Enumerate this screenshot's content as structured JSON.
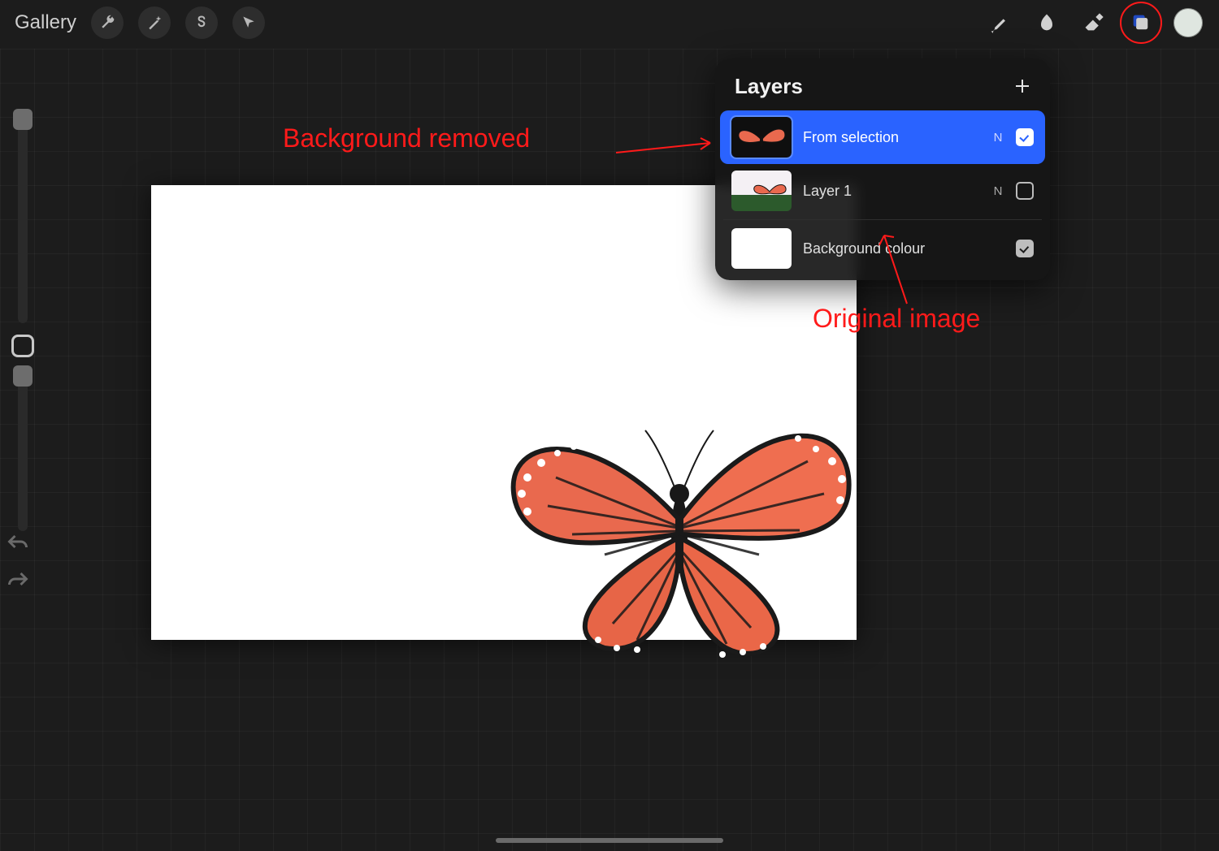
{
  "toolbar": {
    "gallery_label": "Gallery"
  },
  "layers_panel": {
    "title": "Layers",
    "rows": [
      {
        "name": "From selection",
        "blend": "N",
        "visible": true,
        "selected": true
      },
      {
        "name": "Layer 1",
        "blend": "N",
        "visible": false,
        "selected": false
      },
      {
        "name": "Background colour",
        "blend": "",
        "visible": true,
        "selected": false
      }
    ]
  },
  "annotations": {
    "bg_removed": "Background removed",
    "original": "Original image"
  },
  "colors": {
    "accent": "#2a63ff",
    "annotation": "#ff1a1a"
  }
}
